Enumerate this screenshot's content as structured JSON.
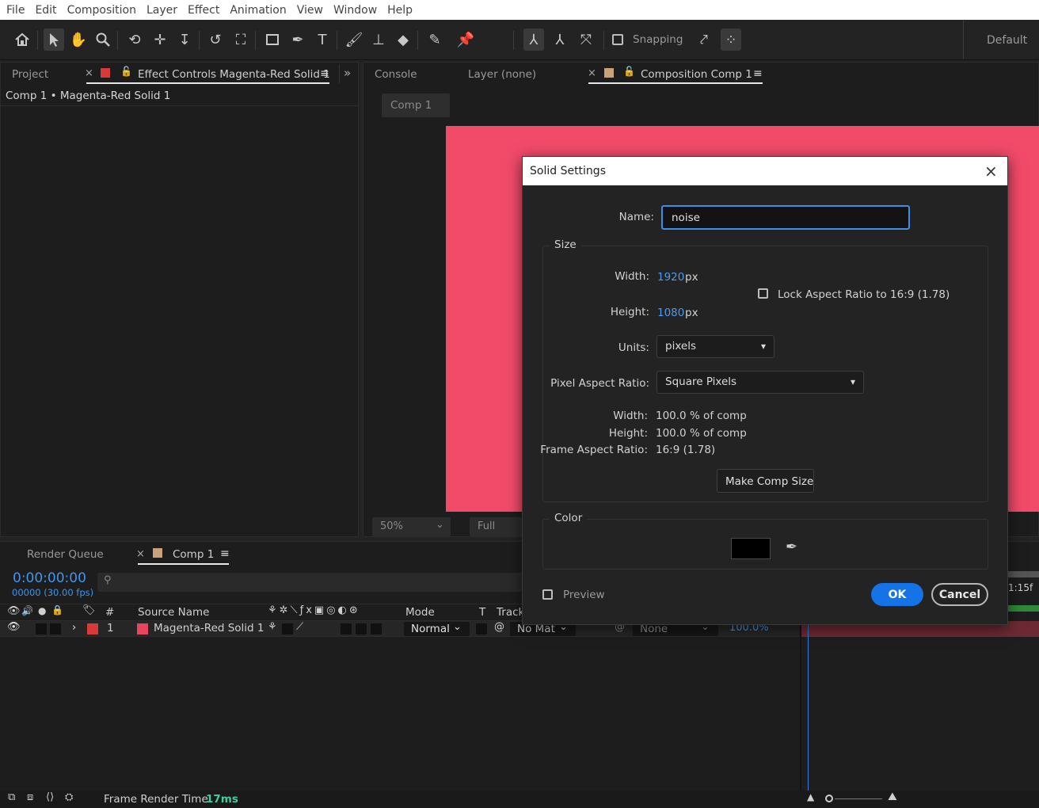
{
  "menu": [
    "File",
    "Edit",
    "Composition",
    "Layer",
    "Effect",
    "Animation",
    "View",
    "Window",
    "Help"
  ],
  "toolbar": {
    "snapping_label": "Snapping",
    "workspace": "Default"
  },
  "left_panel": {
    "project_tab": "Project",
    "effect_tab": "Effect Controls Magenta-Red Solid 1",
    "breadcrumb": "Comp 1 • Magenta-Red Solid 1"
  },
  "viewer": {
    "console_tab": "Console",
    "layer_tab": "Layer (none)",
    "comp_tab": "Composition Comp 1",
    "comp_button": "Comp 1",
    "zoom": "50%",
    "resolution": "Full",
    "solid_color": "#f24b6a"
  },
  "timeline": {
    "render_queue_tab": "Render Queue",
    "comp_tab": "Comp 1",
    "timecode": "0:00:00:00",
    "frames": "00000 (30.00 fps)",
    "ruler_end": "1:15f",
    "columns": {
      "num": "#",
      "source": "Source Name",
      "mode": "Mode",
      "t": "T",
      "track": "Track"
    },
    "layer": {
      "index": "1",
      "name": "Magenta-Red Solid 1",
      "mode": "Normal",
      "matte": "No Mat",
      "parent": "None",
      "stretch": "100.0%",
      "color": "#e8455f"
    },
    "render_time_label": "Frame Render Time:",
    "render_time_value": "17ms"
  },
  "dialog": {
    "title": "Solid Settings",
    "name_label": "Name:",
    "name_value": "noise",
    "size_group": "Size",
    "width_label": "Width:",
    "width_value": "1920",
    "height_label": "Height:",
    "height_value": "1080",
    "px": "px",
    "lock_label": "Lock Aspect Ratio to 16:9 (1.78)",
    "units_label": "Units:",
    "units_value": "pixels",
    "par_label": "Pixel Aspect Ratio:",
    "par_value": "Square Pixels",
    "pct_width_label": "Width:",
    "pct_width_value": "100.0 % of comp",
    "pct_height_label": "Height:",
    "pct_height_value": "100.0 % of comp",
    "far_label": "Frame Aspect Ratio:",
    "far_value": "16:9 (1.78)",
    "make_comp_size": "Make Comp Size",
    "color_group": "Color",
    "color_value": "#000000",
    "preview_label": "Preview",
    "ok": "OK",
    "cancel": "Cancel"
  }
}
